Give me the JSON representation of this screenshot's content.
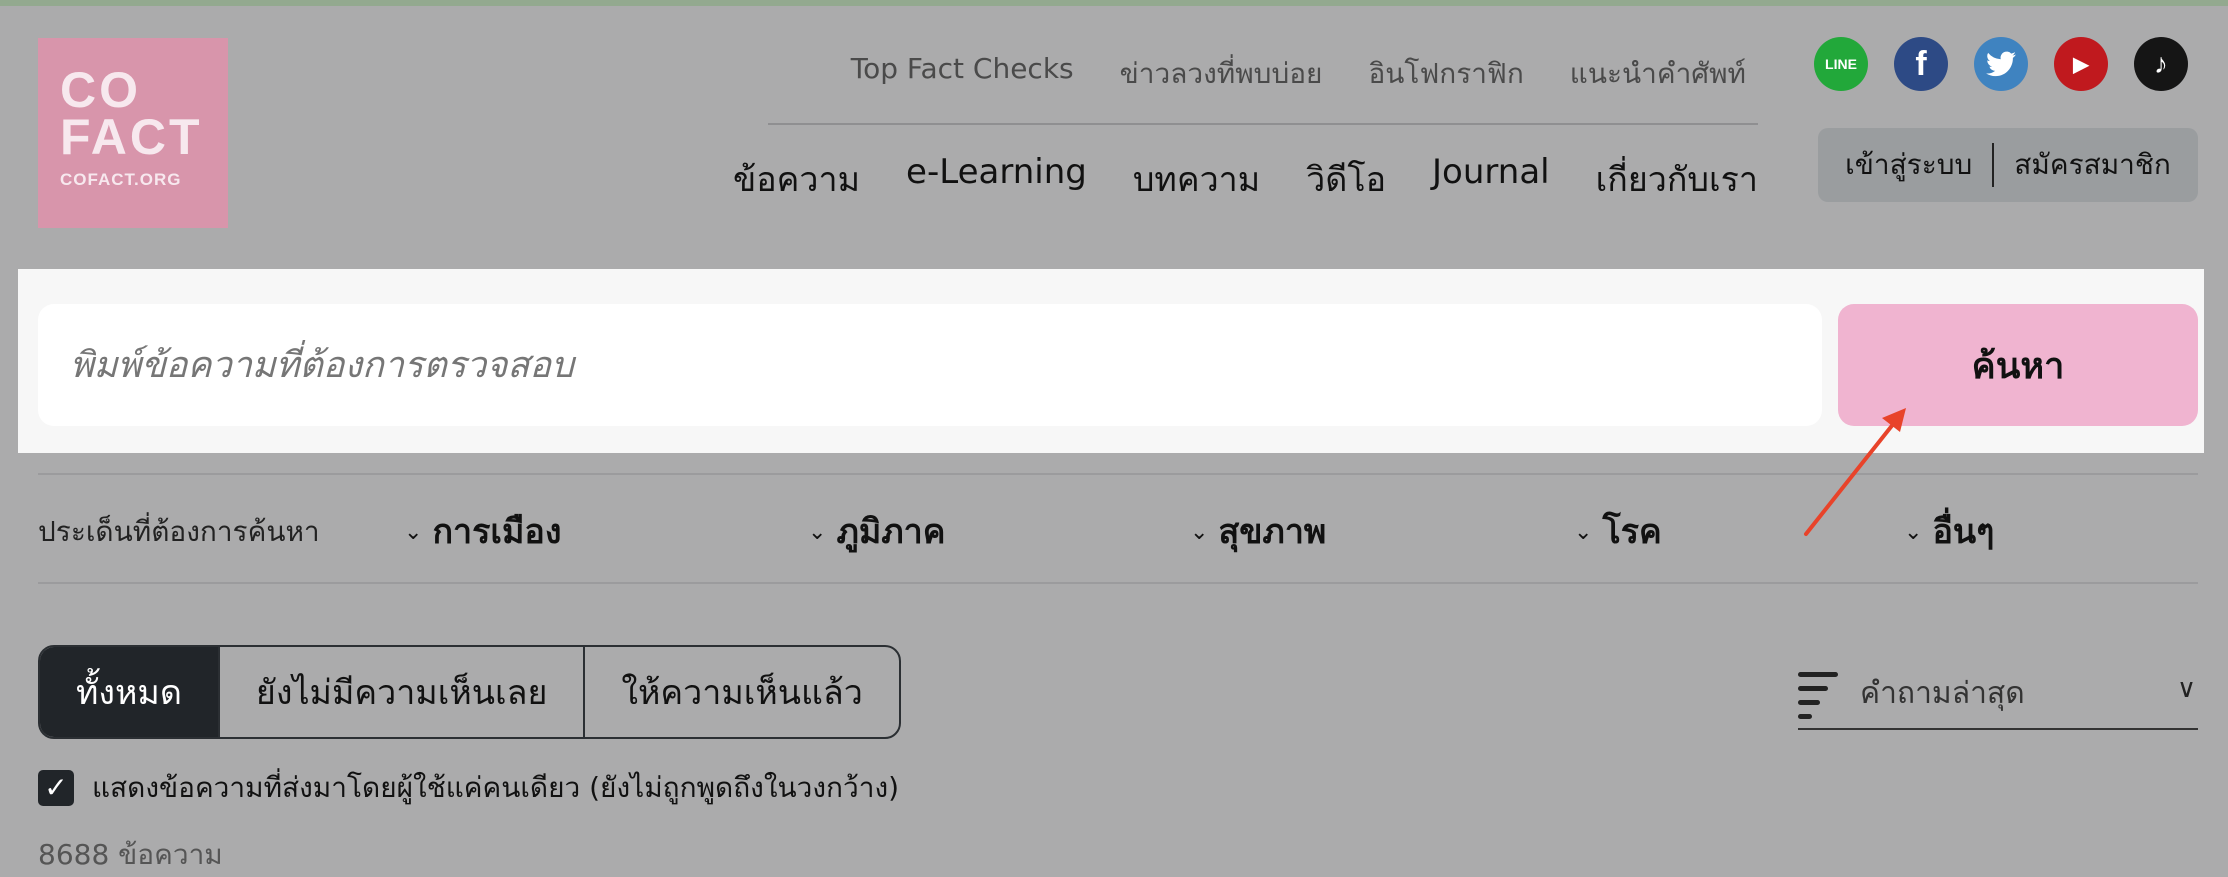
{
  "logo": {
    "line1": "CO",
    "line2": "FACT",
    "line3": "COFACT.ORG"
  },
  "top_links": [
    "Top Fact Checks",
    "ข่าวลวงที่พบบ่อย",
    "อินโฟกราฟิก",
    "แนะนำคำศัพท์"
  ],
  "main_nav": [
    "ข้อความ",
    "e-Learning",
    "บทความ",
    "วิดีโอ",
    "Journal",
    "เกี่ยวกับเรา"
  ],
  "socials": [
    {
      "name": "line",
      "glyph": "LINE",
      "color": "#22a83a"
    },
    {
      "name": "facebook",
      "glyph": "f",
      "color": "#2d4a85"
    },
    {
      "name": "twitter",
      "glyph": "t",
      "color": "#3f83c0"
    },
    {
      "name": "youtube",
      "glyph": "▶",
      "color": "#c0191e"
    },
    {
      "name": "tiktok",
      "glyph": "♪",
      "color": "#151515"
    }
  ],
  "auth": {
    "login": "เข้าสู่ระบบ",
    "register": "สมัครสมาชิก"
  },
  "search": {
    "placeholder": "พิมพ์ข้อความที่ต้องการตรวจสอบ",
    "button": "ค้นหา"
  },
  "filters": {
    "label": "ประเด็นที่ต้องการค้นหา",
    "items": [
      "การเมือง",
      "ภูมิภาค",
      "สุขภาพ",
      "โรค",
      "อื่นๆ"
    ]
  },
  "tabs": [
    "ทั้งหมด",
    "ยังไม่มีความเห็นเลย",
    "ให้ความเห็นแล้ว"
  ],
  "sort": {
    "selected": "คำถามล่าสุด"
  },
  "checkbox": {
    "label": "แสดงข้อความที่ส่งมาโดยผู้ใช้แค่คนเดียว (ยังไม่ถูกพูดถึงในวงกว้าง)",
    "checked": true
  },
  "result_count": "8688 ข้อความ",
  "colors": {
    "accent_pink": "#f0b4d0",
    "logo_pink": "#d895ab",
    "active_tab": "#212529",
    "arrow": "#e8432a"
  }
}
